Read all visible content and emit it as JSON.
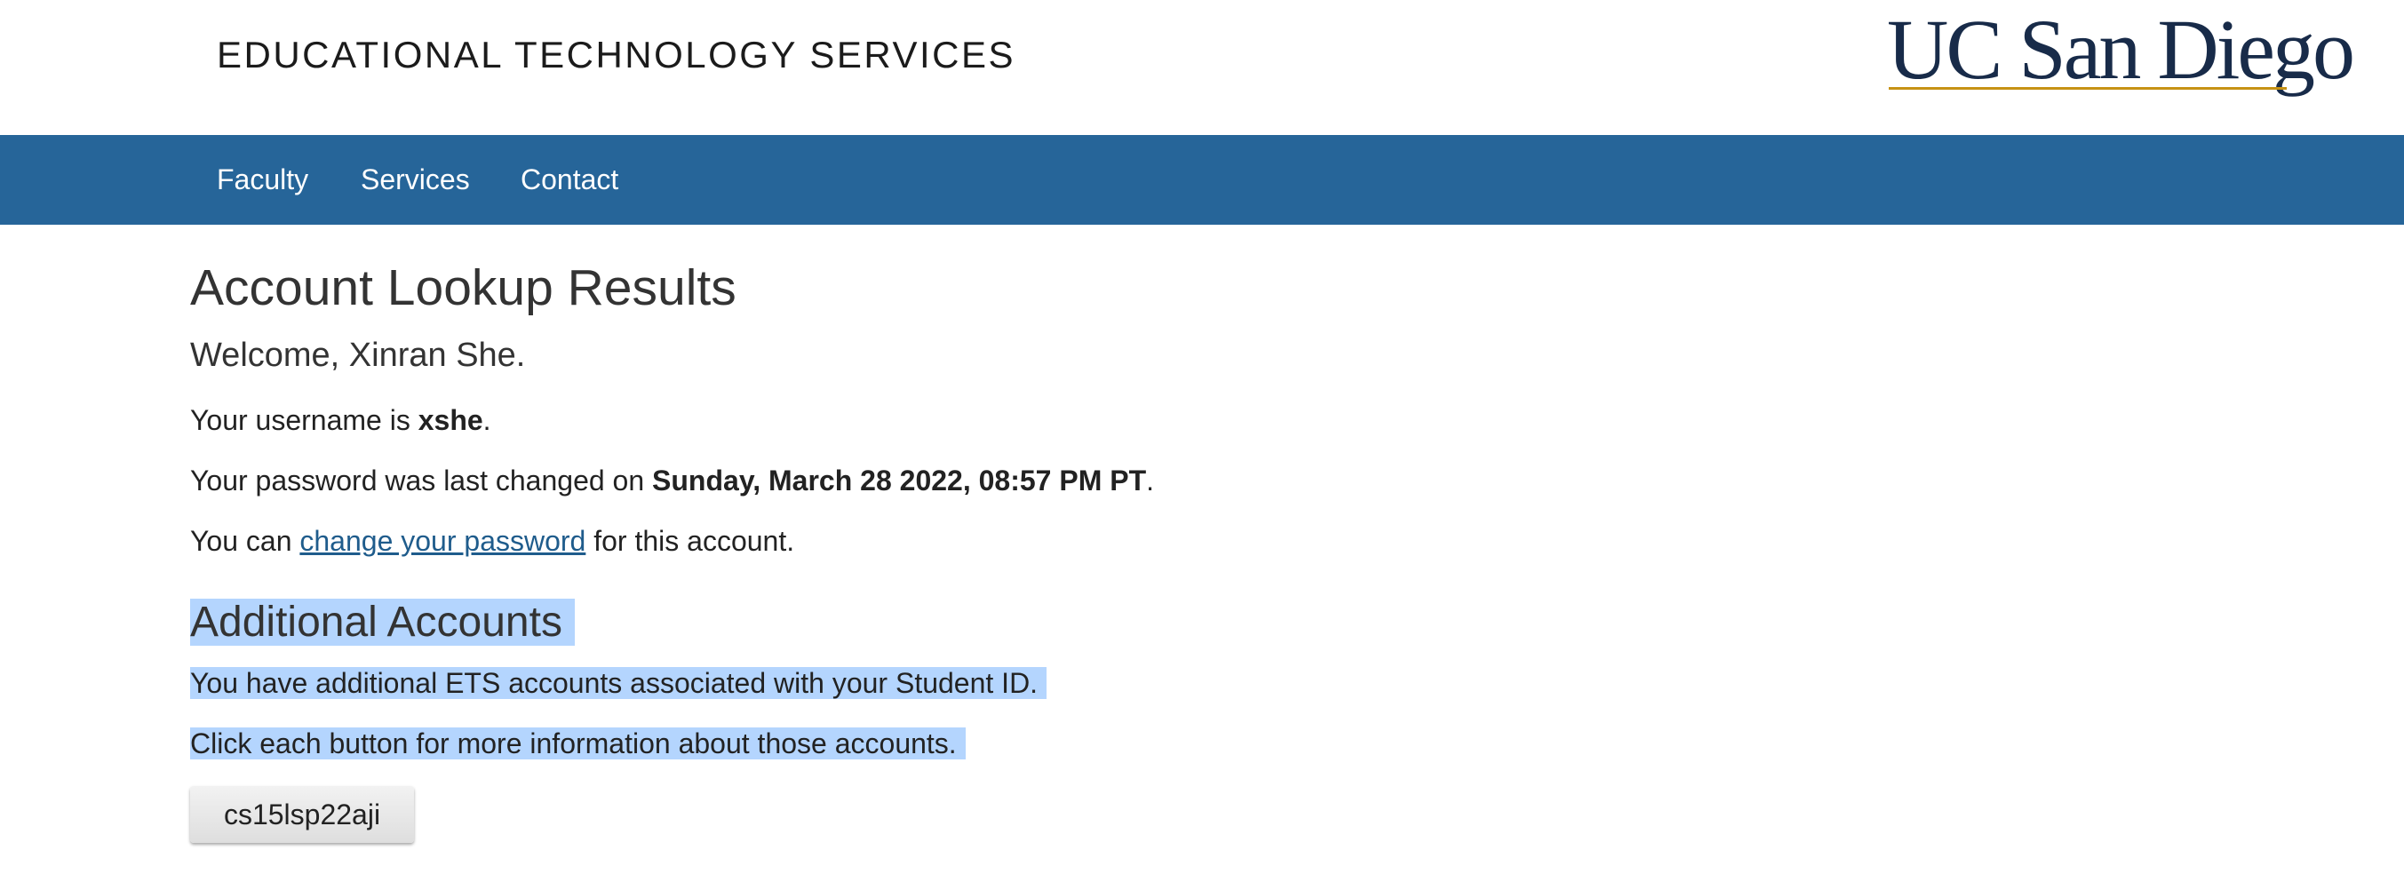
{
  "header": {
    "org_title": "EDUCATIONAL TECHNOLOGY SERVICES",
    "logo_text": "UC San Diego",
    "logo_color": "#182B49",
    "logo_accent": "#C69214"
  },
  "nav": {
    "background": "#266599",
    "items": [
      {
        "label": "Faculty"
      },
      {
        "label": "Services"
      },
      {
        "label": "Contact"
      }
    ]
  },
  "main": {
    "title": "Account Lookup Results",
    "welcome": "Welcome, Xinran She.",
    "username_prefix": "Your username is ",
    "username": "xshe",
    "username_suffix": ".",
    "password_prefix": "Your password was last changed on ",
    "password_changed": "Sunday, March 28 2022, 08:57 PM PT",
    "password_suffix": ".",
    "change_prefix": "You can ",
    "change_link": "change your password",
    "change_suffix": " for this account."
  },
  "additional": {
    "title": "Additional Accounts",
    "line1": "You have additional ETS accounts associated with your Student ID.",
    "line2": "Click each button for more information about those accounts.",
    "accounts": [
      "cs15lsp22aji"
    ]
  }
}
